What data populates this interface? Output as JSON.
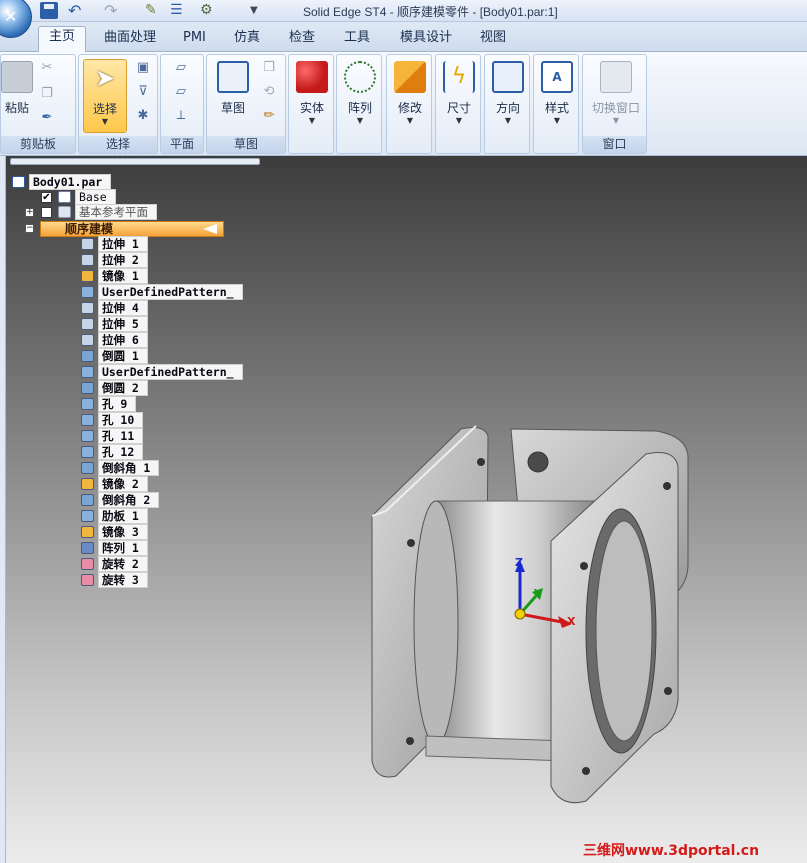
{
  "window": {
    "title": "Solid Edge ST4 - 顺序建模零件 - [Body01.par:1]"
  },
  "ribbon": {
    "tabs": [
      {
        "label": "主页",
        "active": true
      },
      {
        "label": "曲面处理"
      },
      {
        "label": "PMI"
      },
      {
        "label": "仿真"
      },
      {
        "label": "检查"
      },
      {
        "label": "工具"
      },
      {
        "label": "模具设计"
      },
      {
        "label": "视图"
      }
    ],
    "groups": {
      "clipboard": {
        "label": "剪贴板",
        "paste": "粘贴"
      },
      "select": {
        "label": "选择",
        "select_btn": "选择"
      },
      "plane": {
        "label": "平面"
      },
      "sketch": {
        "label": "草图",
        "sketch_btn": "草图"
      },
      "solid": {
        "label": "实体"
      },
      "pattern": {
        "label": "阵列"
      },
      "modify": {
        "label": "修改"
      },
      "dimension": {
        "label": "尺寸"
      },
      "orient": {
        "label": "方向"
      },
      "style": {
        "label": "样式"
      },
      "window": {
        "label": "窗口",
        "switch": "切换窗口"
      }
    }
  },
  "tree": {
    "root": "Body01.par",
    "base": "Base",
    "base_checked": true,
    "ref_planes": "基本参考平面",
    "ref_planes_checked": false,
    "sequential": "顺序建模",
    "features": [
      {
        "label": "拉伸 1",
        "icon": "extrude-icon"
      },
      {
        "label": "拉伸 2",
        "icon": "extrude-icon"
      },
      {
        "label": "镜像 1",
        "icon": "mirror-icon"
      },
      {
        "label": "UserDefinedPattern_",
        "icon": "pattern-icon"
      },
      {
        "label": "拉伸 4",
        "icon": "extrude-icon"
      },
      {
        "label": "拉伸 5",
        "icon": "extrude-icon"
      },
      {
        "label": "拉伸 6",
        "icon": "extrude-icon"
      },
      {
        "label": "倒圆 1",
        "icon": "round-icon"
      },
      {
        "label": "UserDefinedPattern_",
        "icon": "pattern-icon"
      },
      {
        "label": "倒圆 2",
        "icon": "round-icon"
      },
      {
        "label": "孔 9",
        "icon": "hole-icon"
      },
      {
        "label": "孔 10",
        "icon": "hole-icon"
      },
      {
        "label": "孔 11",
        "icon": "hole-icon"
      },
      {
        "label": "孔 12",
        "icon": "hole-icon"
      },
      {
        "label": "倒斜角 1",
        "icon": "chamfer-icon"
      },
      {
        "label": "镜像 2",
        "icon": "mirror-icon"
      },
      {
        "label": "倒斜角 2",
        "icon": "chamfer-icon"
      },
      {
        "label": "肋板 1",
        "icon": "rib-icon"
      },
      {
        "label": "镜像 3",
        "icon": "mirror-icon"
      },
      {
        "label": "阵列 1",
        "icon": "array-icon"
      },
      {
        "label": "旋转 2",
        "icon": "revolve-icon"
      },
      {
        "label": "旋转 3",
        "icon": "revolve-icon"
      }
    ]
  },
  "triad": {
    "x": "X",
    "y": "Y",
    "z": "Z"
  },
  "watermark": "三维网www.3dportal.cn",
  "colors": {
    "active_node": "#f5a23a",
    "watermark": "#d51a1a",
    "axis_x": "#d01a1a",
    "axis_y": "#1a9a1a",
    "axis_z": "#1a2ad0"
  }
}
